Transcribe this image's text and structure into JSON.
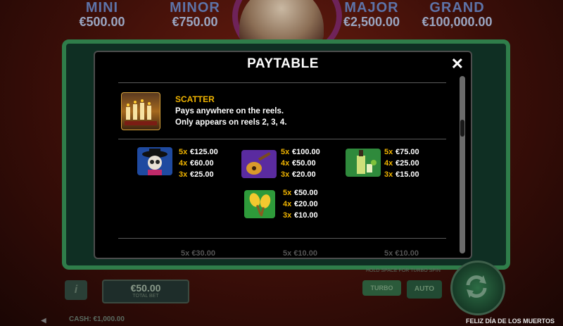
{
  "jackpots": [
    {
      "name": "MINI",
      "amount": "€500.00"
    },
    {
      "name": "MINOR",
      "amount": "€750.00"
    },
    {
      "name": "MAJOR",
      "amount": "€2,500.00"
    },
    {
      "name": "GRAND",
      "amount": "€100,000.00"
    }
  ],
  "modal": {
    "title": "PAYTABLE",
    "close_label": "✕",
    "scatter": {
      "title": "SCATTER",
      "line1": "Pays anywhere on the reels.",
      "line2": "Only appears on reels 2, 3, 4."
    },
    "symbols": [
      {
        "icon": "day-of-dead-man-icon",
        "pays": [
          {
            "k": "5x",
            "v": "€125.00"
          },
          {
            "k": "4x",
            "v": "€60.00"
          },
          {
            "k": "3x",
            "v": "€25.00"
          }
        ]
      },
      {
        "icon": "guitar-icon",
        "pays": [
          {
            "k": "5x",
            "v": "€100.00"
          },
          {
            "k": "4x",
            "v": "€50.00"
          },
          {
            "k": "3x",
            "v": "€20.00"
          }
        ]
      },
      {
        "icon": "tequila-bottle-icon",
        "pays": [
          {
            "k": "5x",
            "v": "€75.00"
          },
          {
            "k": "4x",
            "v": "€25.00"
          },
          {
            "k": "3x",
            "v": "€15.00"
          }
        ]
      },
      {
        "icon": "maracas-icon",
        "pays": [
          {
            "k": "5x",
            "v": "€50.00"
          },
          {
            "k": "4x",
            "v": "€20.00"
          },
          {
            "k": "3x",
            "v": "€10.00"
          }
        ]
      }
    ],
    "next_row_peek": [
      {
        "k": "5x",
        "v": "€30.00"
      },
      {
        "k": "5x",
        "v": "€10.00"
      },
      {
        "k": "5x",
        "v": "€10.00"
      }
    ]
  },
  "controls": {
    "info_label": "i",
    "bet_value": "€50.00",
    "bet_label": "TOTAL BET",
    "turbo_label": "TURBO",
    "auto_label": "AUTO",
    "hold_text": "HOLD SPACE FOR TURBO SPIN",
    "cash_label": "CASH: €1,000.00"
  },
  "footer": {
    "game_title": "FELIZ DÍA DE LOS MUERTOS"
  },
  "colors": {
    "accent": "#f0b400",
    "modal_bg": "#000000",
    "frame": "#2f7d4a"
  }
}
